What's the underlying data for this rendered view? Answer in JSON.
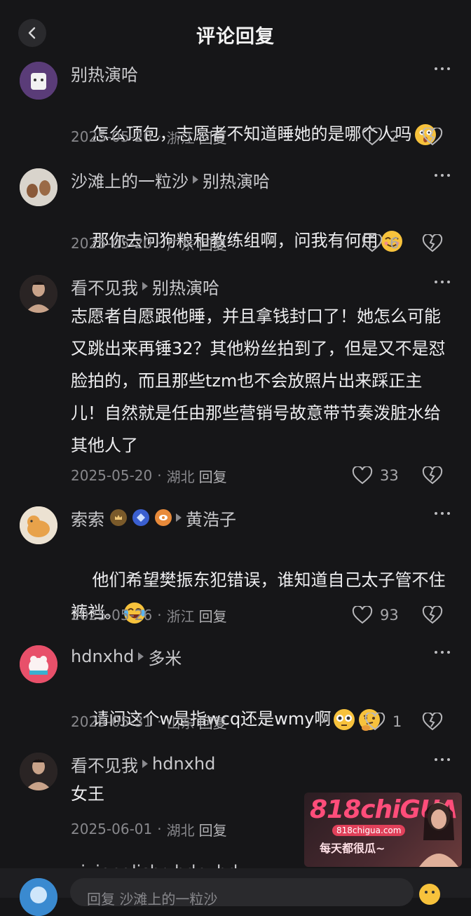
{
  "header": {
    "title": "评论回复"
  },
  "comments": [
    {
      "user": "别热演哈",
      "reply_to": "",
      "text": "怎么顶包，志愿者不知道睡她的是哪个人吗",
      "date": "2025-05-20",
      "region": "浙江",
      "reply_label": "回复",
      "likes": "2",
      "avatar_color": "#5a3c78"
    },
    {
      "user": "沙滩上的一粒沙",
      "reply_to": "别热演哈",
      "text": "那你去问狗粮和教练组啊，问我有何用",
      "date": "2025-05-20",
      "region": "广东",
      "reply_label": "回复",
      "likes": "6",
      "avatar_color": "#d9d4cc"
    },
    {
      "user": "看不见我",
      "reply_to": "别热演哈",
      "text": "志愿者自愿跟他睡，并且拿钱封口了！她怎么可能又跳出来再锤32？其他粉丝拍到了，但是又不是怼脸拍的，而且那些tzm也不会放照片出来踩正主儿！自然就是任由那些营销号故意带节奏泼脏水给其他人了",
      "date": "2025-05-20",
      "region": "湖北",
      "reply_label": "回复",
      "likes": "33",
      "avatar_color": "#3a3030"
    },
    {
      "user": "索索",
      "reply_to": "黄浩子",
      "text": "他们希望樊振东犯错误，谁知道自己太子管不住裤裆。",
      "date": "2025-05-26",
      "region": "浙江",
      "reply_label": "回复",
      "likes": "93",
      "avatar_color": "#e9d8c0"
    },
    {
      "user": "hdnxhd",
      "reply_to": "多米",
      "text": "请问这个w是指wcq还是wmy啊",
      "date": "2025-05-31",
      "region": "山东",
      "reply_label": "回复",
      "likes": "1",
      "avatar_color": "#e8506a"
    },
    {
      "user": "看不见我",
      "reply_to": "hdnxhd",
      "text": "女王",
      "date": "2025-06-01",
      "region": "湖北",
      "reply_label": "回复",
      "likes": "",
      "avatar_color": "#3a3030"
    },
    {
      "user": "yiyienglish",
      "reply_to": "hdnxhd",
      "text": "",
      "date": "",
      "region": "",
      "reply_label": "",
      "likes": ""
    }
  ],
  "input": {
    "placeholder": "回复 沙滩上的一粒沙"
  },
  "ad": {
    "brand": "818chiGUA",
    "site": "818chigua.com",
    "slogan": "每天都很瓜~"
  },
  "colors": {
    "background": "#161618",
    "text": "#ededef",
    "meta": "#88888c"
  }
}
